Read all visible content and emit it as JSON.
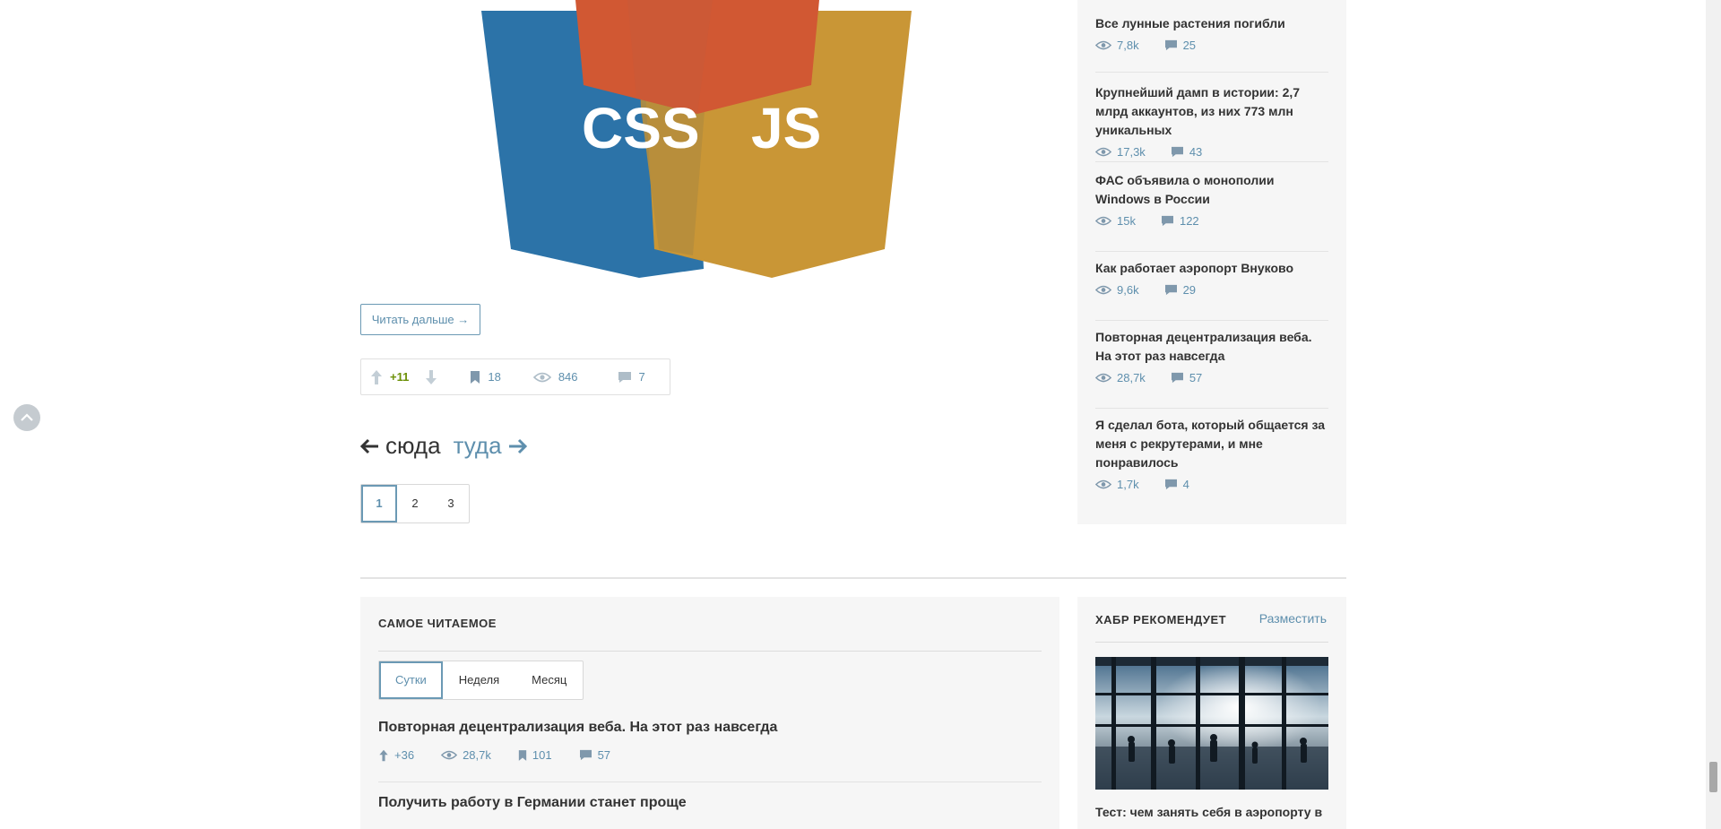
{
  "article": {
    "logo_text_left": "CSS",
    "logo_text_right": "JS",
    "read_more": "Читать дальше →",
    "score": "+11",
    "bookmarks": "18",
    "views": "846",
    "comments": "7"
  },
  "pager": {
    "prev": "сюда",
    "next": "туда",
    "pages": [
      "1",
      "2",
      "3"
    ],
    "current": "1"
  },
  "sidebar": {
    "items": [
      {
        "title": "Все лунные растения погибли",
        "views": "7,8k",
        "comments": "25"
      },
      {
        "title": "Крупнейший дамп в истории: 2,7 млрд аккаунтов, из них 773 млн уникальных",
        "views": "17,3k",
        "comments": "43"
      },
      {
        "title": "ФАС объявила о монополии Windows в России",
        "views": "15k",
        "comments": "122"
      },
      {
        "title": "Как работает аэропорт Внуково",
        "views": "9,6k",
        "comments": "29"
      },
      {
        "title": "Повторная децентрализация веба. На этот раз навсегда",
        "views": "28,7k",
        "comments": "57"
      },
      {
        "title": "Я сделал бота, который общается за меня с рекрутерами, и мне понравилось",
        "views": "1,7k",
        "comments": "4"
      }
    ]
  },
  "most_read": {
    "title": "САМОЕ ЧИТАЕМОЕ",
    "tabs": [
      "Сутки",
      "Неделя",
      "Месяц"
    ],
    "active_tab": "Сутки",
    "items": [
      {
        "title": "Повторная децентрализация веба. На этот раз навсегда",
        "score": "+36",
        "views": "28,7k",
        "bookmarks": "101",
        "comments": "57"
      },
      {
        "title": "Получить работу в Германии станет проще",
        "score": "",
        "views": "",
        "bookmarks": "",
        "comments": ""
      }
    ]
  },
  "recommend": {
    "title": "ХАБР РЕКОМЕНДУЕТ",
    "place_link": "Разместить",
    "caption": "Тест: чем занять себя в аэропорту в"
  },
  "colors": {
    "accent": "#5e8fad",
    "score_positive": "#6c9007",
    "css_blue": "#2c73a8",
    "js_gold": "#c99636",
    "html_orange": "#d15833"
  },
  "icons": [
    "arrow-up-icon",
    "arrow-down-icon",
    "bookmark-icon",
    "eye-icon",
    "comment-icon",
    "scroll-top-icon"
  ]
}
